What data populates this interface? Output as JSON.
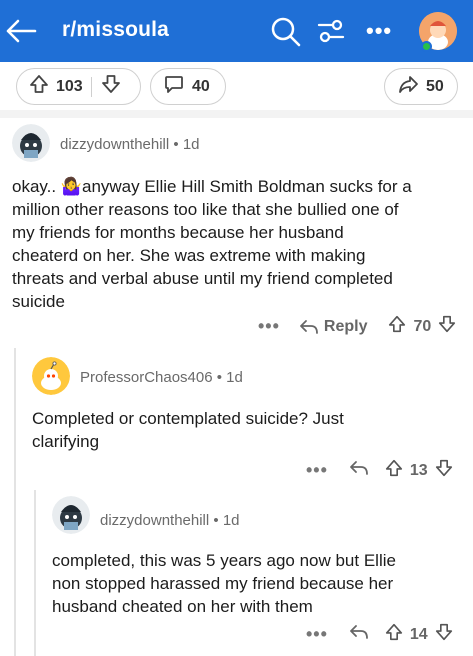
{
  "header": {
    "subreddit": "r/missoula",
    "icons": [
      "back-arrow-icon",
      "search-icon",
      "filter-icon",
      "more-icon",
      "profile-avatar"
    ]
  },
  "post_actions": {
    "upvotes": "103",
    "comments": "40",
    "shares": "50"
  },
  "comments": [
    {
      "author": "dizzydownthehill",
      "age": "1d",
      "lines": [
        "okay.. 🤷‍♀️anyway Ellie Hill Smith Boldman  sucks for a",
        "million other reasons too like that she bullied one of",
        "my friends for months because her husband",
        "cheaterd on her. She was extreme with making",
        "threats and verbal abuse until my friend completed",
        "suicide"
      ],
      "reply_label": "Reply",
      "votes": "70"
    },
    {
      "author": "ProfessorChaos406",
      "age": "1d",
      "lines": [
        "Completed or contemplated suicide? Just",
        "clarifying"
      ],
      "votes": "13"
    },
    {
      "author": "dizzydownthehill",
      "age": "1d",
      "lines": [
        "completed, this was 5 years ago now but Ellie",
        "non stopped harassed my friend because her",
        "husband cheated on her with them"
      ],
      "votes": "14"
    }
  ],
  "colors": {
    "header_bg": "#1f6fd6",
    "online": "#27c14a"
  }
}
